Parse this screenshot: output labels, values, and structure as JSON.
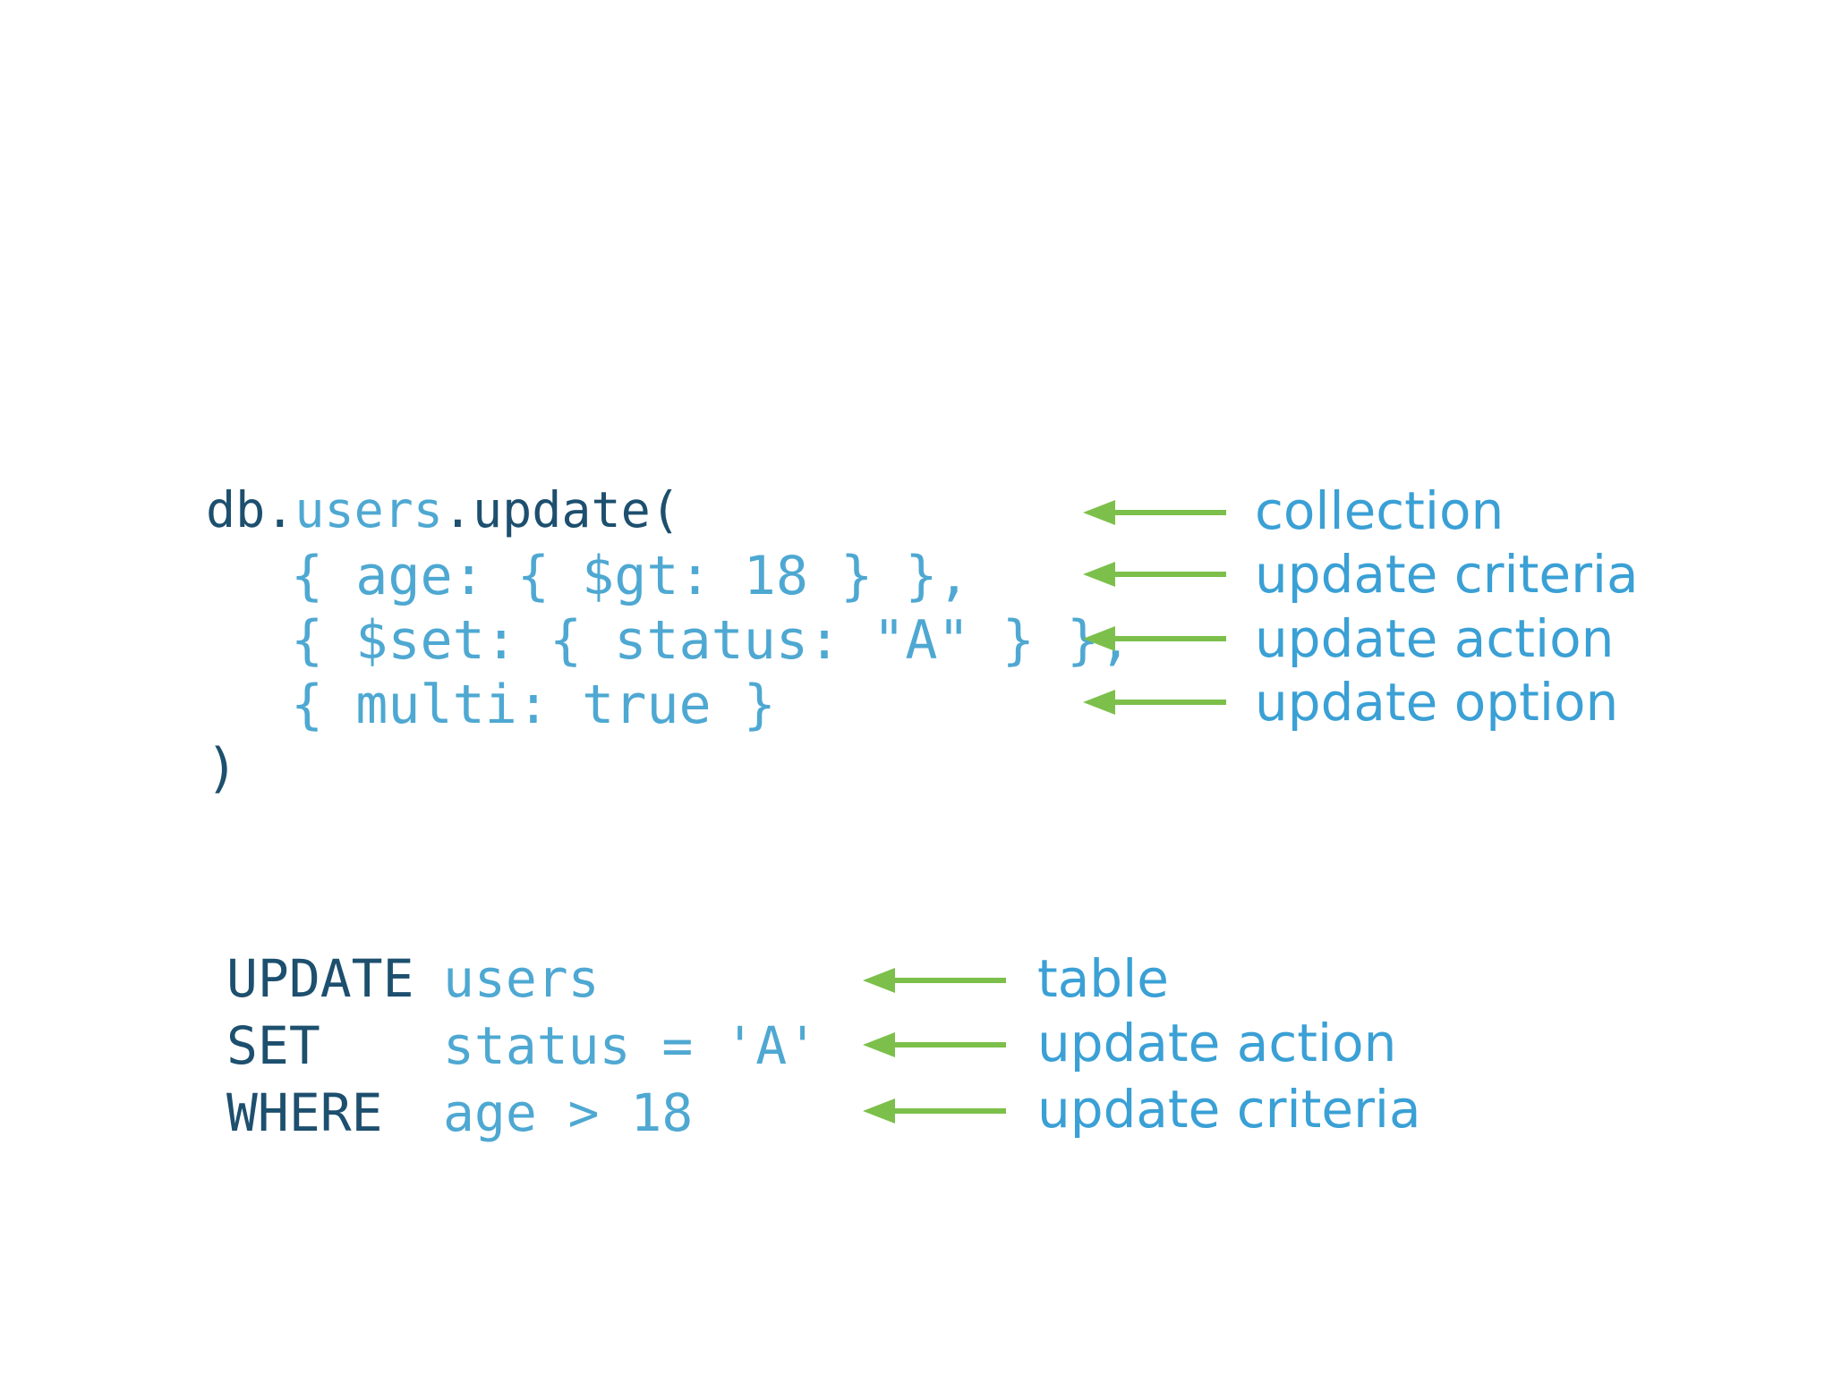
{
  "mongo": {
    "line1": {
      "a": "db.",
      "b": "users",
      "c": ".update("
    },
    "line2": "{ age: { $gt: 18 } },",
    "line3": "{ $set: { status: \"A\" } },",
    "line4": "{ multi: true }",
    "line5": ")",
    "labels": [
      "collection",
      "update criteria",
      "update action",
      "update option"
    ]
  },
  "sql": {
    "rows": [
      {
        "kw": "UPDATE",
        "val": "users"
      },
      {
        "kw": "SET",
        "val": "status = 'A'"
      },
      {
        "kw": "WHERE",
        "val": "age > 18"
      }
    ],
    "labels": [
      "table",
      "update action",
      "update criteria"
    ]
  },
  "colors": {
    "keyword": "#1d4f6e",
    "value": "#4ea8d2",
    "label": "#3aa0d5",
    "arrow": "#7cc04b"
  }
}
